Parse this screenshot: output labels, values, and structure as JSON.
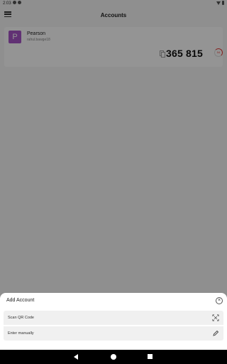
{
  "status_bar": {
    "time": "2:03"
  },
  "app_bar": {
    "title": "Accounts"
  },
  "accounts": [
    {
      "avatar_letter": "P",
      "issuer": "Pearson",
      "name": "rahul.bawge18",
      "code": "365 815",
      "seconds_left": "04"
    }
  ],
  "sheet": {
    "title": "Add Account",
    "options": [
      {
        "label": "Scan QR Code",
        "icon": "qr-scan-icon"
      },
      {
        "label": "Enter manually",
        "icon": "pencil-icon"
      }
    ]
  },
  "colors": {
    "avatar": "#a855c8",
    "timer": "#e53935"
  }
}
